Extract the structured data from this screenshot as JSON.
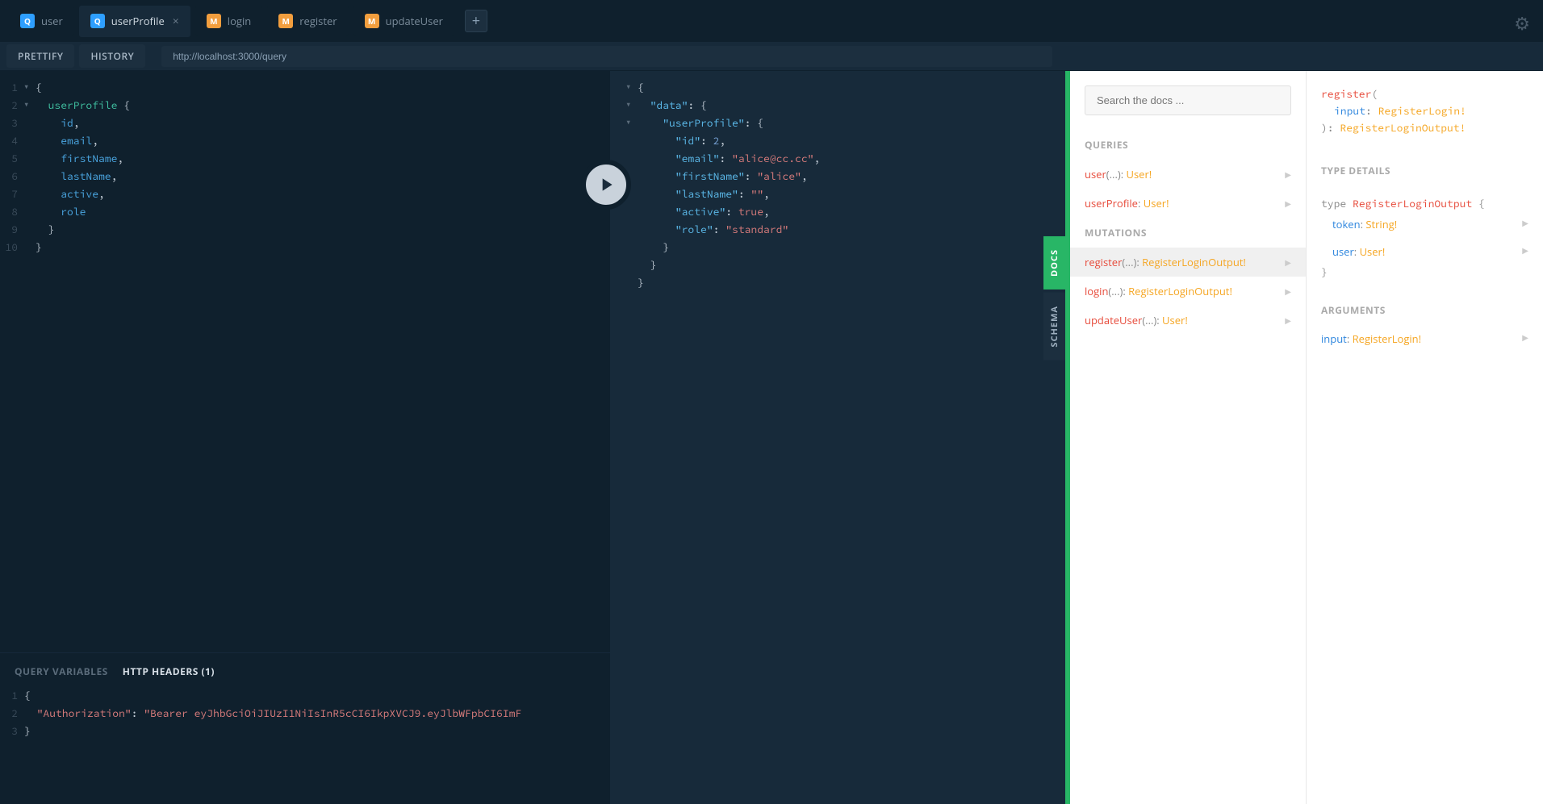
{
  "tabs": [
    {
      "label": "user",
      "type": "Q"
    },
    {
      "label": "userProfile",
      "type": "Q",
      "active": true
    },
    {
      "label": "login",
      "type": "M"
    },
    {
      "label": "register",
      "type": "M"
    },
    {
      "label": "updateUser",
      "type": "M"
    }
  ],
  "toolbar": {
    "prettify": "PRETTIFY",
    "history": "HISTORY",
    "url": "http://localhost:3000/query"
  },
  "query": {
    "lines": [
      "1",
      "2",
      "3",
      "4",
      "5",
      "6",
      "7",
      "8",
      "9",
      "10"
    ],
    "root": "userProfile",
    "fields": [
      "id",
      "email",
      "firstName",
      "lastName",
      "active",
      "role"
    ]
  },
  "result": {
    "data_key": "\"data\"",
    "profile_key": "\"userProfile\"",
    "fields": {
      "id": {
        "k": "\"id\"",
        "v": "2",
        "type": "num"
      },
      "email": {
        "k": "\"email\"",
        "v": "\"alice@cc.cc\"",
        "type": "str"
      },
      "firstName": {
        "k": "\"firstName\"",
        "v": "\"alice\"",
        "type": "str"
      },
      "lastName": {
        "k": "\"lastName\"",
        "v": "\"\"",
        "type": "str"
      },
      "active": {
        "k": "\"active\"",
        "v": "true",
        "type": "bool"
      },
      "role": {
        "k": "\"role\"",
        "v": "\"standard\"",
        "type": "str"
      }
    }
  },
  "vars": {
    "tabs": {
      "qv": "QUERY VARIABLES",
      "hh": "HTTP HEADERS (1)"
    },
    "lines": [
      "1",
      "2",
      "3"
    ],
    "header_key": "\"Authorization\"",
    "header_val": "\"Bearer eyJhbGciOiJIUzI1NiIsInR5cCI6IkpXVCJ9.eyJlbWFpbCI6ImF"
  },
  "side": {
    "docs": "DOCS",
    "schema": "SCHEMA"
  },
  "docs": {
    "search_placeholder": "Search the docs ...",
    "queries_title": "QUERIES",
    "mutations_title": "MUTATIONS",
    "queries": [
      {
        "name": "user",
        "args": "(...)",
        "type": "User!"
      },
      {
        "name": "userProfile",
        "args": "",
        "type": "User!"
      }
    ],
    "mutations": [
      {
        "name": "register",
        "args": "(...)",
        "type": "RegisterLoginOutput!",
        "selected": true
      },
      {
        "name": "login",
        "args": "(...)",
        "type": "RegisterLoginOutput!"
      },
      {
        "name": "updateUser",
        "args": "(...)",
        "type": "User!"
      }
    ],
    "detail": {
      "name": "register",
      "input_label": "input",
      "input_type": "RegisterLogin!",
      "return_type": "RegisterLoginOutput!",
      "type_details_title": "TYPE DETAILS",
      "type_keyword": "type",
      "type_name": "RegisterLoginOutput",
      "fields": [
        {
          "name": "token",
          "type": "String!"
        },
        {
          "name": "user",
          "type": "User!"
        }
      ],
      "arguments_title": "ARGUMENTS",
      "arg_name": "input",
      "arg_type": "RegisterLogin!"
    }
  }
}
